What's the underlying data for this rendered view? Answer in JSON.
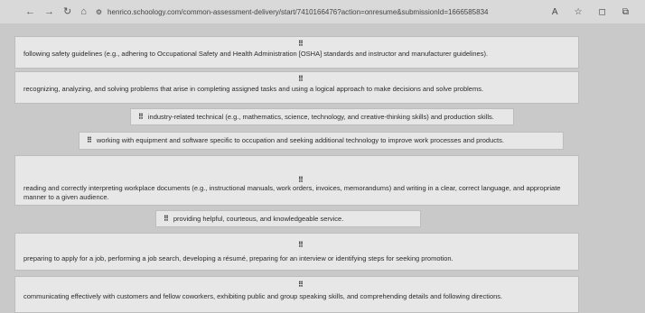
{
  "browser": {
    "url": "henrico.schoology.com/common-assessment-delivery/start/7410166476?action=onresume&submissionId=1666585834",
    "back_icon": "arrow-left",
    "forward_icon": "arrow-right",
    "reload_icon": "reload",
    "home_icon": "home"
  },
  "items": [
    {
      "handle": "⠿",
      "text": "following safety guidelines (e.g., adhering to Occupational Safety and Health Administration [OSHA] standards and instructor and manufacturer guidelines)."
    },
    {
      "handle": "⠿",
      "text": "recognizing, analyzing, and solving problems that arise in completing assigned tasks and using a logical approach to make decisions and solve problems."
    },
    {
      "handle": "⠿",
      "text": "industry-related technical (e.g., mathematics, science, technology, and creative-thinking skills) and production skills."
    },
    {
      "handle": "⠿",
      "text": "working with equipment and software specific to occupation and seeking additional technology to improve work processes and products."
    },
    {
      "handle": "⠿",
      "text": "reading and correctly interpreting workplace documents (e.g., instructional manuals, work orders, invoices, memorandums) and writing in a clear, correct language, and appropriate manner to a given audience."
    },
    {
      "handle": "⠿",
      "text": "providing helpful, courteous, and knowledgeable service."
    },
    {
      "handle": "⠿",
      "text": "preparing to apply for a job, performing a job search, developing a résumé, preparing for an interview or identifying steps for seeking promotion."
    },
    {
      "handle": "⠿",
      "text": "communicating effectively with customers and fellow coworkers, exhibiting public and group speaking skills, and comprehending details and following directions."
    }
  ]
}
